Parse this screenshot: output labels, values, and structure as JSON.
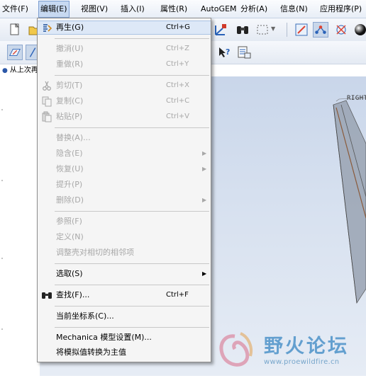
{
  "menubar": {
    "items": [
      {
        "label": "文件(F)"
      },
      {
        "label": "编辑(E)"
      },
      {
        "label": "视图(V)"
      },
      {
        "label": "插入(I)"
      },
      {
        "label": "属性(R)"
      },
      {
        "label": "AutoGEM"
      },
      {
        "label": "分析(A)"
      },
      {
        "label": "信息(N)"
      },
      {
        "label": "应用程序(P)"
      }
    ]
  },
  "model_tree": {
    "first_item": "从上次再"
  },
  "viewport": {
    "datum_label": "RIGHT"
  },
  "edit_menu": {
    "items": [
      {
        "label": "再生(G)",
        "accel": "Ctrl+G",
        "enabled": true,
        "icon": "regenerate-icon"
      },
      {
        "label": "撤消(U)",
        "accel": "Ctrl+Z",
        "enabled": false
      },
      {
        "label": "重做(R)",
        "accel": "Ctrl+Y",
        "enabled": false
      },
      {
        "label": "剪切(T)",
        "accel": "Ctrl+X",
        "enabled": false,
        "icon": "scissors-icon"
      },
      {
        "label": "复制(C)",
        "accel": "Ctrl+C",
        "enabled": false,
        "icon": "copy-icon"
      },
      {
        "label": "粘贴(P)",
        "accel": "Ctrl+V",
        "enabled": false,
        "icon": "paste-icon"
      },
      {
        "label": "替换(A)...",
        "enabled": false
      },
      {
        "label": "隐含(E)",
        "enabled": false,
        "submenu": true
      },
      {
        "label": "恢复(U)",
        "enabled": false,
        "submenu": true
      },
      {
        "label": "提升(P)",
        "enabled": false
      },
      {
        "label": "删除(D)",
        "enabled": false,
        "submenu": true
      },
      {
        "label": "参照(F)",
        "enabled": false
      },
      {
        "label": "定义(N)",
        "enabled": false
      },
      {
        "label": "调整壳对相切的相邻项",
        "enabled": false
      },
      {
        "label": "选取(S)",
        "enabled": true,
        "submenu": true
      },
      {
        "label": "查找(F)...",
        "accel": "Ctrl+F",
        "enabled": true,
        "icon": "binoculars-icon"
      },
      {
        "label": "当前坐标系(C)...",
        "enabled": true
      },
      {
        "label": "Mechanica 模型设置(M)...",
        "enabled": true
      },
      {
        "label": "将模拟值转换为主值",
        "enabled": true
      }
    ]
  },
  "watermark": {
    "title": "野火论坛",
    "url": "www.proewildfire.cn"
  },
  "colors": {
    "accent": "#4d93c9",
    "menu_bg": "#f5f5f5",
    "disabled_text": "#a8a8a8"
  }
}
